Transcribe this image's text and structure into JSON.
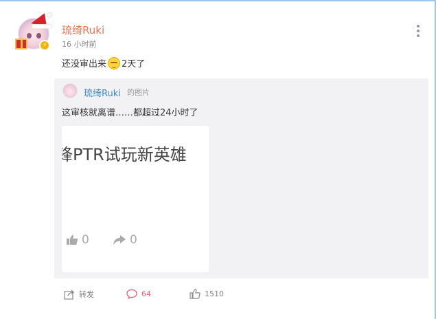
{
  "post": {
    "author": "琉绮Ruki",
    "time": "16 小时前",
    "text_before_emoji": "还没审出来",
    "text_after_emoji": "2天了",
    "emoji": "dizzy-face-emoji"
  },
  "repost": {
    "author": "琉绮Ruki",
    "tag": "的图片",
    "text": "这审核就离谱……都超过24小时了",
    "image": {
      "title": "锋PTR试玩新英雄",
      "likes": "0",
      "shares": "0"
    }
  },
  "actions": {
    "forward_label": "转发",
    "comments": "64",
    "likes": "1510"
  },
  "colors": {
    "username": "#eb7350",
    "repost_username": "#3d87c9",
    "comment": "#eb5f73",
    "repost_bg": "#f2f2f5"
  },
  "icons": [
    "more-vertical-icon",
    "forward-icon",
    "comment-icon",
    "like-icon",
    "thumbs-up-icon",
    "share-arrow-icon"
  ]
}
